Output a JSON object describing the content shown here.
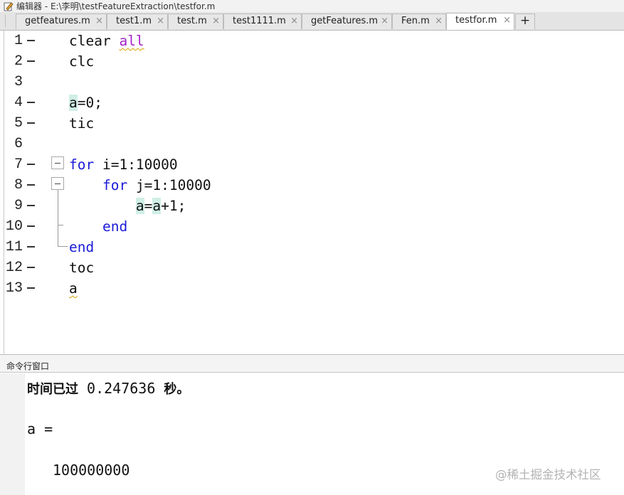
{
  "window": {
    "title": "编辑器 - E:\\李明\\testFeatureExtraction\\testfor.m"
  },
  "tabs": [
    {
      "label": "getfeatures.m",
      "close": "×"
    },
    {
      "label": "test1.m",
      "close": "×"
    },
    {
      "label": "test.m",
      "close": "×"
    },
    {
      "label": "test1111.m",
      "close": "×"
    },
    {
      "label": "getFeatures.m",
      "close": "×"
    },
    {
      "label": "Fen.m",
      "close": "×"
    },
    {
      "label": "testfor.m",
      "close": "×",
      "active": true
    }
  ],
  "add_tab_label": "+",
  "editor": {
    "lines": [
      {
        "num": "1",
        "indent": "",
        "tokens": [
          "clear ",
          "all"
        ]
      },
      {
        "num": "2",
        "indent": "",
        "tokens": [
          "clc"
        ]
      },
      {
        "num": "3",
        "indent": "",
        "tokens": []
      },
      {
        "num": "4",
        "indent": "",
        "tokens": [
          "a",
          "=0;"
        ]
      },
      {
        "num": "5",
        "indent": "",
        "tokens": [
          "tic"
        ]
      },
      {
        "num": "6",
        "indent": "",
        "tokens": []
      },
      {
        "num": "7",
        "indent": "",
        "tokens": [
          "for",
          " i=1:10000"
        ]
      },
      {
        "num": "8",
        "indent": "    ",
        "tokens": [
          "for",
          " j=1:10000"
        ]
      },
      {
        "num": "9",
        "indent": "        ",
        "tokens": [
          "a",
          "=",
          "a",
          "+1;"
        ]
      },
      {
        "num": "10",
        "indent": "    ",
        "tokens": [
          "end"
        ]
      },
      {
        "num": "11",
        "indent": "",
        "tokens": [
          "end"
        ]
      },
      {
        "num": "12",
        "indent": "",
        "tokens": [
          "toc"
        ]
      },
      {
        "num": "13",
        "indent": "",
        "tokens": [
          "a"
        ]
      }
    ]
  },
  "command_window": {
    "title": "命令行窗口",
    "elapsed_label": "时间已过",
    "elapsed_value": " 0.247636 ",
    "elapsed_unit": "秒。",
    "var_line": "a =",
    "value_line": "100000000"
  },
  "watermark": "@稀土掘金技术社区",
  "colors": {
    "keyword": "#1a1ad8",
    "string": "#a521c8",
    "variable_highlight": "#cfeee6"
  }
}
